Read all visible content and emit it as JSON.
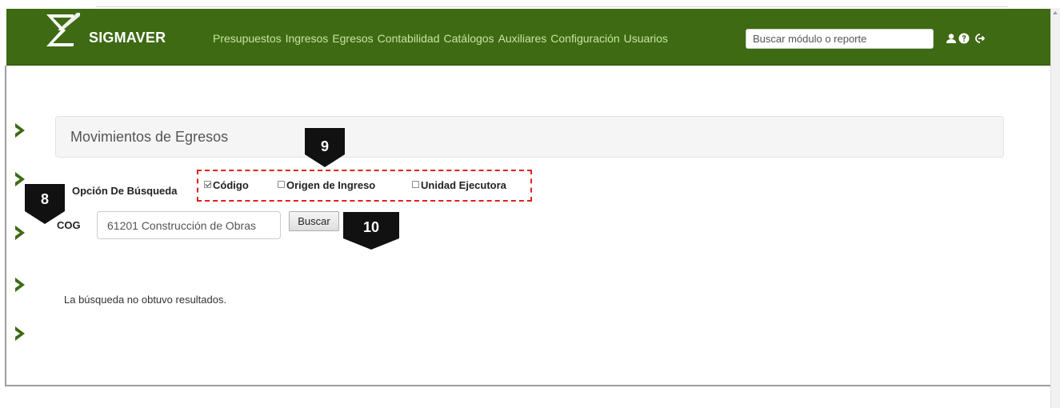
{
  "app": {
    "brand": "SIGMAVER"
  },
  "nav": {
    "items": [
      "Presupuestos",
      "Ingresos",
      "Egresos",
      "Contabilidad",
      "Catálogos",
      "Auxiliares",
      "Configuración",
      "Usuarios"
    ],
    "search_placeholder": "Buscar módulo o reporte",
    "icons": [
      "user-icon",
      "help-circle-icon",
      "logout-icon"
    ]
  },
  "panel": {
    "title": "Movimientos de Egresos"
  },
  "search_options": {
    "label": "Opción De Búsqueda",
    "options": [
      {
        "label": "Código",
        "checked": true
      },
      {
        "label": "Origen de Ingreso",
        "checked": false
      },
      {
        "label": "Unidad Ejecutora",
        "checked": false
      }
    ]
  },
  "cog": {
    "label": "COG",
    "value": "61201 Construcción de Obras",
    "button": "Buscar"
  },
  "result": {
    "message": "La búsqueda no obtuvo resultados."
  },
  "callouts": [
    "8",
    "9",
    "10"
  ],
  "colors": {
    "navbar": "#3e6a14",
    "menu_text": "#c7e69e",
    "chevron": "#3e6a14",
    "callout": "#111111",
    "highlight_box": "#e02020"
  }
}
